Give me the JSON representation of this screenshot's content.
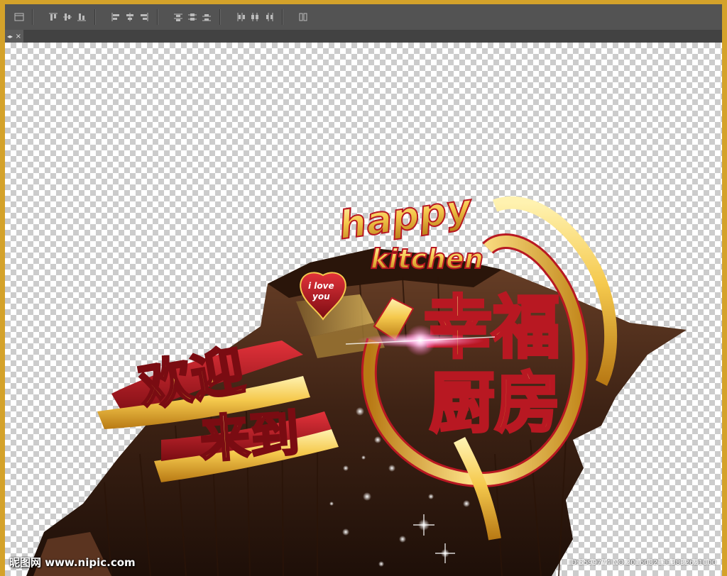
{
  "toolbar": {
    "buttons": [
      "align-top-icon",
      "align-vcenter-icon",
      "align-bottom-icon",
      "align-left-icon",
      "align-hcenter-icon",
      "align-right-icon",
      "distribute-top-icon",
      "distribute-vcenter-icon",
      "distribute-bottom-icon",
      "distribute-left-icon",
      "distribute-hcenter-icon",
      "distribute-right-icon",
      "auto-align-icon"
    ]
  },
  "tab": {
    "label": "",
    "close_glyph": "×"
  },
  "artwork": {
    "english_line1": "happy",
    "english_line2": "kitchen",
    "heart_line1": "i love",
    "heart_line2": "you",
    "welcome_line1": "欢迎",
    "welcome_line2": "来到",
    "happy_line1": "幸福",
    "happy_line2": "厨房"
  },
  "watermark": {
    "left": "昵图网 www.nipic.com",
    "right": "ID:5599774 NO:20160821113832621000"
  },
  "colors": {
    "frame": "#d4a22a",
    "toolbar": "#535353",
    "gold": "#f2c24a",
    "red": "#b81822",
    "wood": "#4a2a18"
  }
}
